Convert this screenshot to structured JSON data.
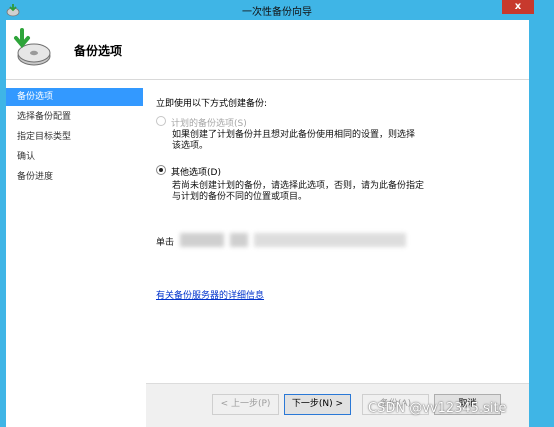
{
  "window": {
    "title": "一次性备份向导",
    "close_label": "x"
  },
  "header": {
    "title": "备份选项"
  },
  "nav": {
    "items": [
      {
        "label": "备份选项",
        "active": true
      },
      {
        "label": "选择备份配置",
        "active": false
      },
      {
        "label": "指定目标类型",
        "active": false
      },
      {
        "label": "确认",
        "active": false
      },
      {
        "label": "备份进度",
        "active": false
      }
    ]
  },
  "content": {
    "intro": "立即使用以下方式创建备份:",
    "option_scheduled": {
      "label": "计划的备份选项(S)",
      "selected": false,
      "disabled": true,
      "description_line1": "如果创建了计划备份并且想对此备份使用相同的设置，则选择",
      "description_line2": "该选项。"
    },
    "option_other": {
      "label": "其他选项(D)",
      "selected": true,
      "disabled": false,
      "description_line1": "若尚未创建计划的备份，请选择此选项，否则，请为此备份指定",
      "description_line2": "与计划的备份不同的位置或项目。"
    },
    "blurred_prefix": "单击",
    "link_text": "有关备份服务器的详细信息"
  },
  "footer": {
    "back_label": "< 上一步(P)",
    "next_label": "下一步(N) >",
    "backup_label": "备份(A)",
    "cancel_label": "取消"
  },
  "watermark": "CSDN @vv12345.site"
}
